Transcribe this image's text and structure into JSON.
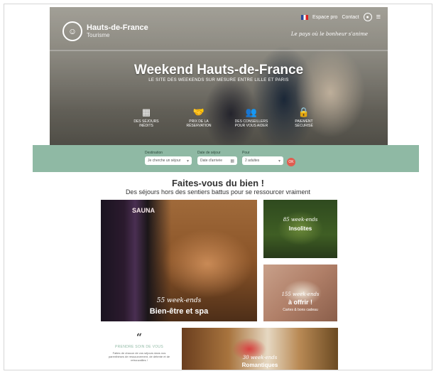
{
  "brand": {
    "name": "Hauts-de-France",
    "sub": "Tourisme"
  },
  "topbar": {
    "link1": "Espace pro",
    "link2": "Contact",
    "tagline": "Le pays où le bonheur s'anime"
  },
  "hero": {
    "title": "Weekend Hauts-de-France",
    "subtitle": "LE SITE DES WEEKENDS SUR MESURE ENTRE LILLE ET PARIS",
    "features": [
      {
        "icon": "calendar-icon",
        "label": "DES SÉJOURS INÉDITS"
      },
      {
        "icon": "handshake-icon",
        "label": "PRIX DE LA RÉSERVATION"
      },
      {
        "icon": "advisors-icon",
        "label": "DES CONSEILLERS POUR VOUS AIDER"
      },
      {
        "icon": "lock-icon",
        "label": "PAIEMENT SÉCURISÉ"
      }
    ]
  },
  "search": {
    "dest_label": "Destination",
    "dest_value": "Je cherche un séjour",
    "date_label": "Date de séjour",
    "date_value": "Date d'arrivée",
    "for_label": "Pour",
    "for_value": "2 adultes",
    "button": "OK"
  },
  "section": {
    "title": "Faites-vous du bien !",
    "subtitle": "Des séjours hors des sentiers battus pour se ressourcer vraiment"
  },
  "cards": {
    "spa": {
      "script": "55 week-ends",
      "title": "Bien-être et spa",
      "sauna": "SAUNA"
    },
    "insolites": {
      "script": "85 week-ends",
      "title": "Insolites"
    },
    "offrir": {
      "script": "155 week-ends",
      "title": "à offrir !",
      "sub": "Cartes & bons cadeau"
    },
    "quote": {
      "mark": "“",
      "heading": "PRENDRE SOIN DE VOUS",
      "text": "Faites de chacun de vos séjours dans nos parenthèses de ressourcement, de détente et de retrouvailles !"
    },
    "roman": {
      "script": "30 week-ends",
      "title": "Romantiques"
    }
  }
}
